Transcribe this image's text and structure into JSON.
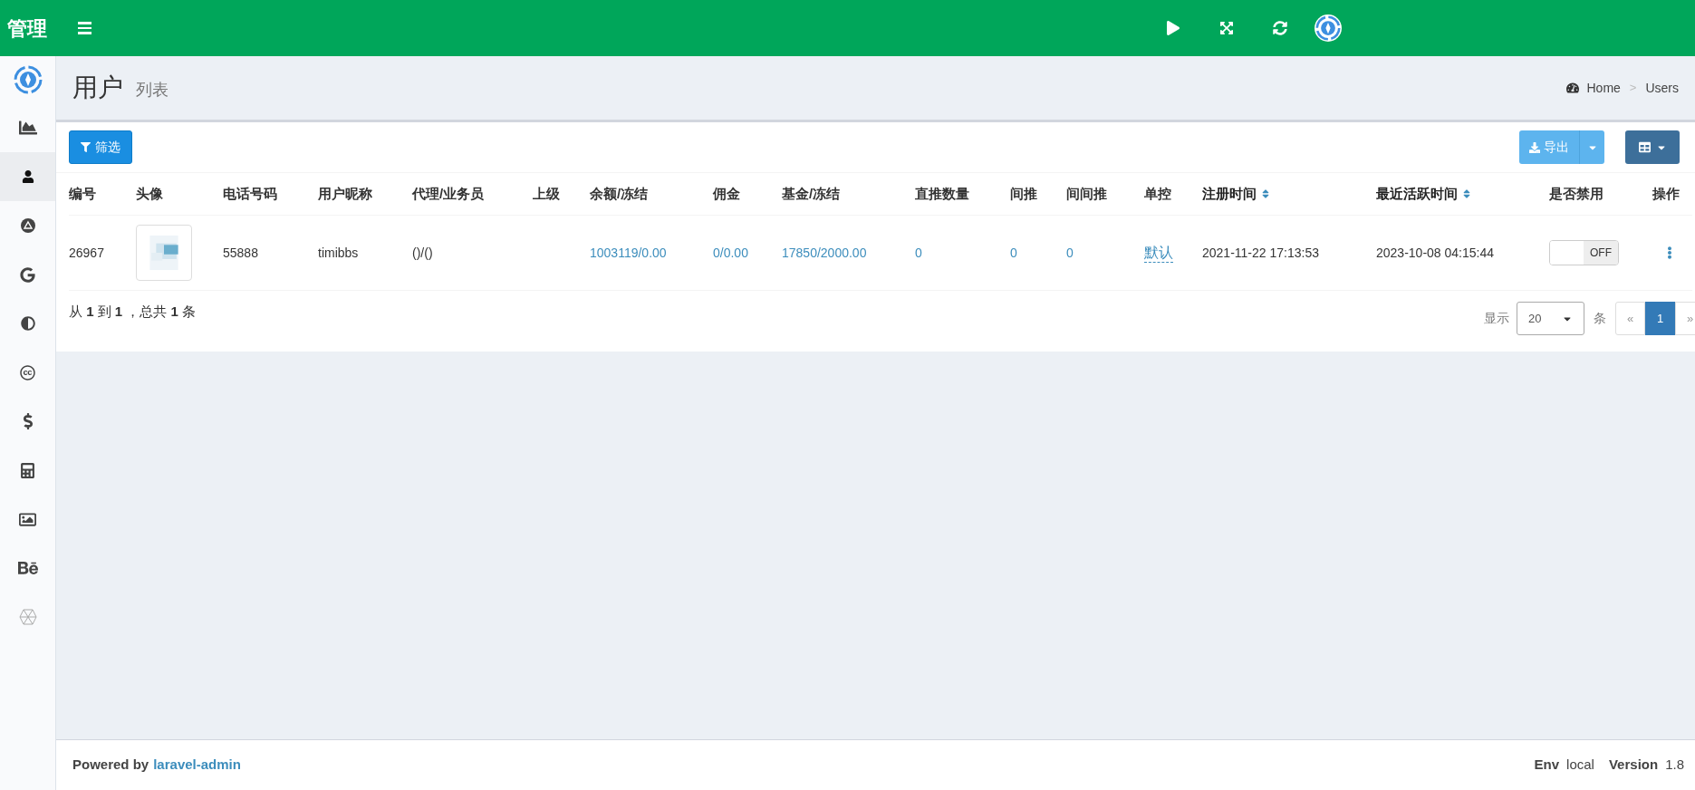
{
  "top_bar": {
    "brand": "管理"
  },
  "sidebar": {
    "items": [
      {
        "selected": false
      },
      {
        "selected": true
      },
      {
        "selected": false
      },
      {
        "selected": false
      },
      {
        "selected": false
      },
      {
        "selected": false
      },
      {
        "selected": false
      },
      {
        "selected": false
      },
      {
        "selected": false
      },
      {
        "selected": false
      },
      {
        "selected": false
      }
    ]
  },
  "header": {
    "title": "用户",
    "subtitle": "列表",
    "breadcrumb": [
      "Home",
      ">",
      "Users"
    ]
  },
  "toolbar": {
    "filter_button": "筛选",
    "export_button": "导出"
  },
  "table": {
    "columns": [
      {
        "label": "编号",
        "sortable": false
      },
      {
        "label": "头像",
        "sortable": false
      },
      {
        "label": "电话号码",
        "sortable": false
      },
      {
        "label": "用户昵称",
        "sortable": false
      },
      {
        "label": "代理/业务员",
        "sortable": false
      },
      {
        "label": "上级",
        "sortable": false
      },
      {
        "label": "余额/冻结",
        "sortable": false
      },
      {
        "label": "佣金",
        "sortable": false
      },
      {
        "label": "基金/冻结",
        "sortable": false
      },
      {
        "label": "直推数量",
        "sortable": false
      },
      {
        "label": "间推",
        "sortable": false
      },
      {
        "label": "间间推",
        "sortable": false
      },
      {
        "label": "单控",
        "sortable": false
      },
      {
        "label": "注册时间",
        "sortable": true
      },
      {
        "label": "最近活跃时间",
        "sortable": true
      },
      {
        "label": "是否禁用",
        "sortable": false
      },
      {
        "label": "操作",
        "sortable": false
      }
    ],
    "rows": [
      {
        "cells": [
          {
            "kind": "text",
            "text": "26967"
          },
          {
            "kind": "avatar"
          },
          {
            "kind": "text",
            "text": "55888"
          },
          {
            "kind": "text",
            "text": "timibbs"
          },
          {
            "kind": "text",
            "text": "()/()"
          },
          {
            "kind": "empty"
          },
          {
            "kind": "link",
            "text": "1003119/0.00"
          },
          {
            "kind": "link",
            "text": "0/0.00"
          },
          {
            "kind": "link",
            "text": "17850/2000.00"
          },
          {
            "kind": "link",
            "text": "0"
          },
          {
            "kind": "link",
            "text": "0"
          },
          {
            "kind": "link",
            "text": "0"
          },
          {
            "kind": "editable",
            "text": "默认"
          },
          {
            "kind": "text",
            "text": "2021-11-22 17:13:53"
          },
          {
            "kind": "text",
            "text": "2023-10-08 04:15:44"
          },
          {
            "kind": "switch",
            "on": false,
            "text": "OFF"
          },
          {
            "kind": "menu"
          }
        ]
      }
    ]
  },
  "pagination": {
    "summary": "从 **1** 到 **1** ，总共 **1** 条",
    "show_label": "显示",
    "per_page": "20",
    "unit": "条",
    "pages": [
      {
        "label": "«",
        "selected": false
      },
      {
        "label": "1",
        "selected": true
      },
      {
        "label": "»",
        "selected": false
      }
    ]
  },
  "footer": {
    "powered_by": "Powered by",
    "link": "laravel-admin",
    "env_label": "Env",
    "env": "local",
    "version_label": "Version",
    "version": "1.8"
  }
}
